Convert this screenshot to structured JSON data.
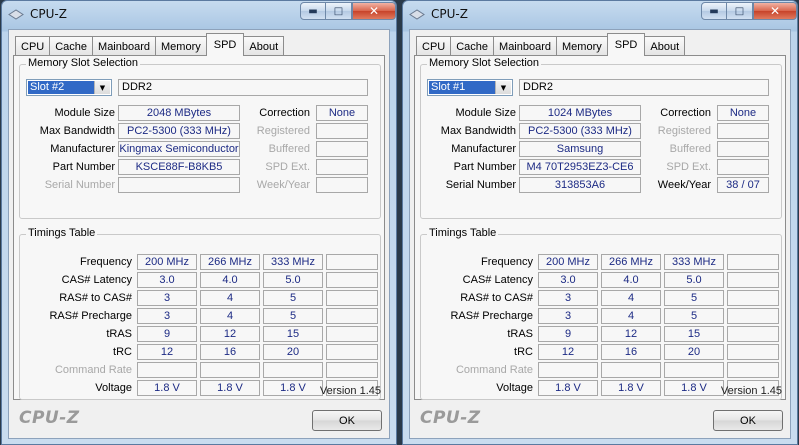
{
  "windows": [
    {
      "title": "CPU-Z",
      "tabs": [
        "CPU",
        "Cache",
        "Mainboard",
        "Memory",
        "SPD",
        "About"
      ],
      "active_tab": "SPD",
      "memory_slot_selection": {
        "group_label": "Memory Slot Selection",
        "slot": "Slot #2",
        "type": "DDR2",
        "fields": {
          "module_size": {
            "label": "Module Size",
            "value": "2048 MBytes"
          },
          "max_bandwidth": {
            "label": "Max Bandwidth",
            "value": "PC2-5300 (333 MHz)"
          },
          "manufacturer": {
            "label": "Manufacturer",
            "value": "Kingmax Semiconductor"
          },
          "part_number": {
            "label": "Part Number",
            "value": "KSCE88F-B8KB5"
          },
          "serial_number": {
            "label": "Serial Number",
            "value": ""
          },
          "correction": {
            "label": "Correction",
            "value": "None"
          },
          "registered": {
            "label": "Registered",
            "value": ""
          },
          "buffered": {
            "label": "Buffered",
            "value": ""
          },
          "spd_ext": {
            "label": "SPD Ext.",
            "value": ""
          },
          "week_year": {
            "label": "Week/Year",
            "value": ""
          }
        }
      },
      "timings_table": {
        "group_label": "Timings Table",
        "rows": [
          {
            "label": "Frequency",
            "values": [
              "200 MHz",
              "266 MHz",
              "333 MHz",
              ""
            ]
          },
          {
            "label": "CAS# Latency",
            "values": [
              "3.0",
              "4.0",
              "5.0",
              ""
            ]
          },
          {
            "label": "RAS# to CAS#",
            "values": [
              "3",
              "4",
              "5",
              ""
            ]
          },
          {
            "label": "RAS# Precharge",
            "values": [
              "3",
              "4",
              "5",
              ""
            ]
          },
          {
            "label": "tRAS",
            "values": [
              "9",
              "12",
              "15",
              ""
            ]
          },
          {
            "label": "tRC",
            "values": [
              "12",
              "16",
              "20",
              ""
            ]
          },
          {
            "label": "Command Rate",
            "values": [
              "",
              "",
              "",
              ""
            ]
          },
          {
            "label": "Voltage",
            "values": [
              "1.8 V",
              "1.8 V",
              "1.8 V",
              ""
            ]
          }
        ]
      },
      "version": "Version 1.45",
      "brand": "CPU-Z",
      "ok_label": "OK"
    },
    {
      "title": "CPU-Z",
      "tabs": [
        "CPU",
        "Cache",
        "Mainboard",
        "Memory",
        "SPD",
        "About"
      ],
      "active_tab": "SPD",
      "memory_slot_selection": {
        "group_label": "Memory Slot Selection",
        "slot": "Slot #1",
        "type": "DDR2",
        "fields": {
          "module_size": {
            "label": "Module Size",
            "value": "1024 MBytes"
          },
          "max_bandwidth": {
            "label": "Max Bandwidth",
            "value": "PC2-5300 (333 MHz)"
          },
          "manufacturer": {
            "label": "Manufacturer",
            "value": "Samsung"
          },
          "part_number": {
            "label": "Part Number",
            "value": "M4 70T2953EZ3-CE6"
          },
          "serial_number": {
            "label": "Serial Number",
            "value": "313853A6"
          },
          "correction": {
            "label": "Correction",
            "value": "None"
          },
          "registered": {
            "label": "Registered",
            "value": ""
          },
          "buffered": {
            "label": "Buffered",
            "value": ""
          },
          "spd_ext": {
            "label": "SPD Ext.",
            "value": ""
          },
          "week_year": {
            "label": "Week/Year",
            "value": "38 / 07"
          }
        }
      },
      "timings_table": {
        "group_label": "Timings Table",
        "rows": [
          {
            "label": "Frequency",
            "values": [
              "200 MHz",
              "266 MHz",
              "333 MHz",
              ""
            ]
          },
          {
            "label": "CAS# Latency",
            "values": [
              "3.0",
              "4.0",
              "5.0",
              ""
            ]
          },
          {
            "label": "RAS# to CAS#",
            "values": [
              "3",
              "4",
              "5",
              ""
            ]
          },
          {
            "label": "RAS# Precharge",
            "values": [
              "3",
              "4",
              "5",
              ""
            ]
          },
          {
            "label": "tRAS",
            "values": [
              "9",
              "12",
              "15",
              ""
            ]
          },
          {
            "label": "tRC",
            "values": [
              "12",
              "16",
              "20",
              ""
            ]
          },
          {
            "label": "Command Rate",
            "values": [
              "",
              "",
              "",
              ""
            ]
          },
          {
            "label": "Voltage",
            "values": [
              "1.8 V",
              "1.8 V",
              "1.8 V",
              ""
            ]
          }
        ]
      },
      "version": "Version 1.45",
      "brand": "CPU-Z",
      "ok_label": "OK"
    }
  ]
}
